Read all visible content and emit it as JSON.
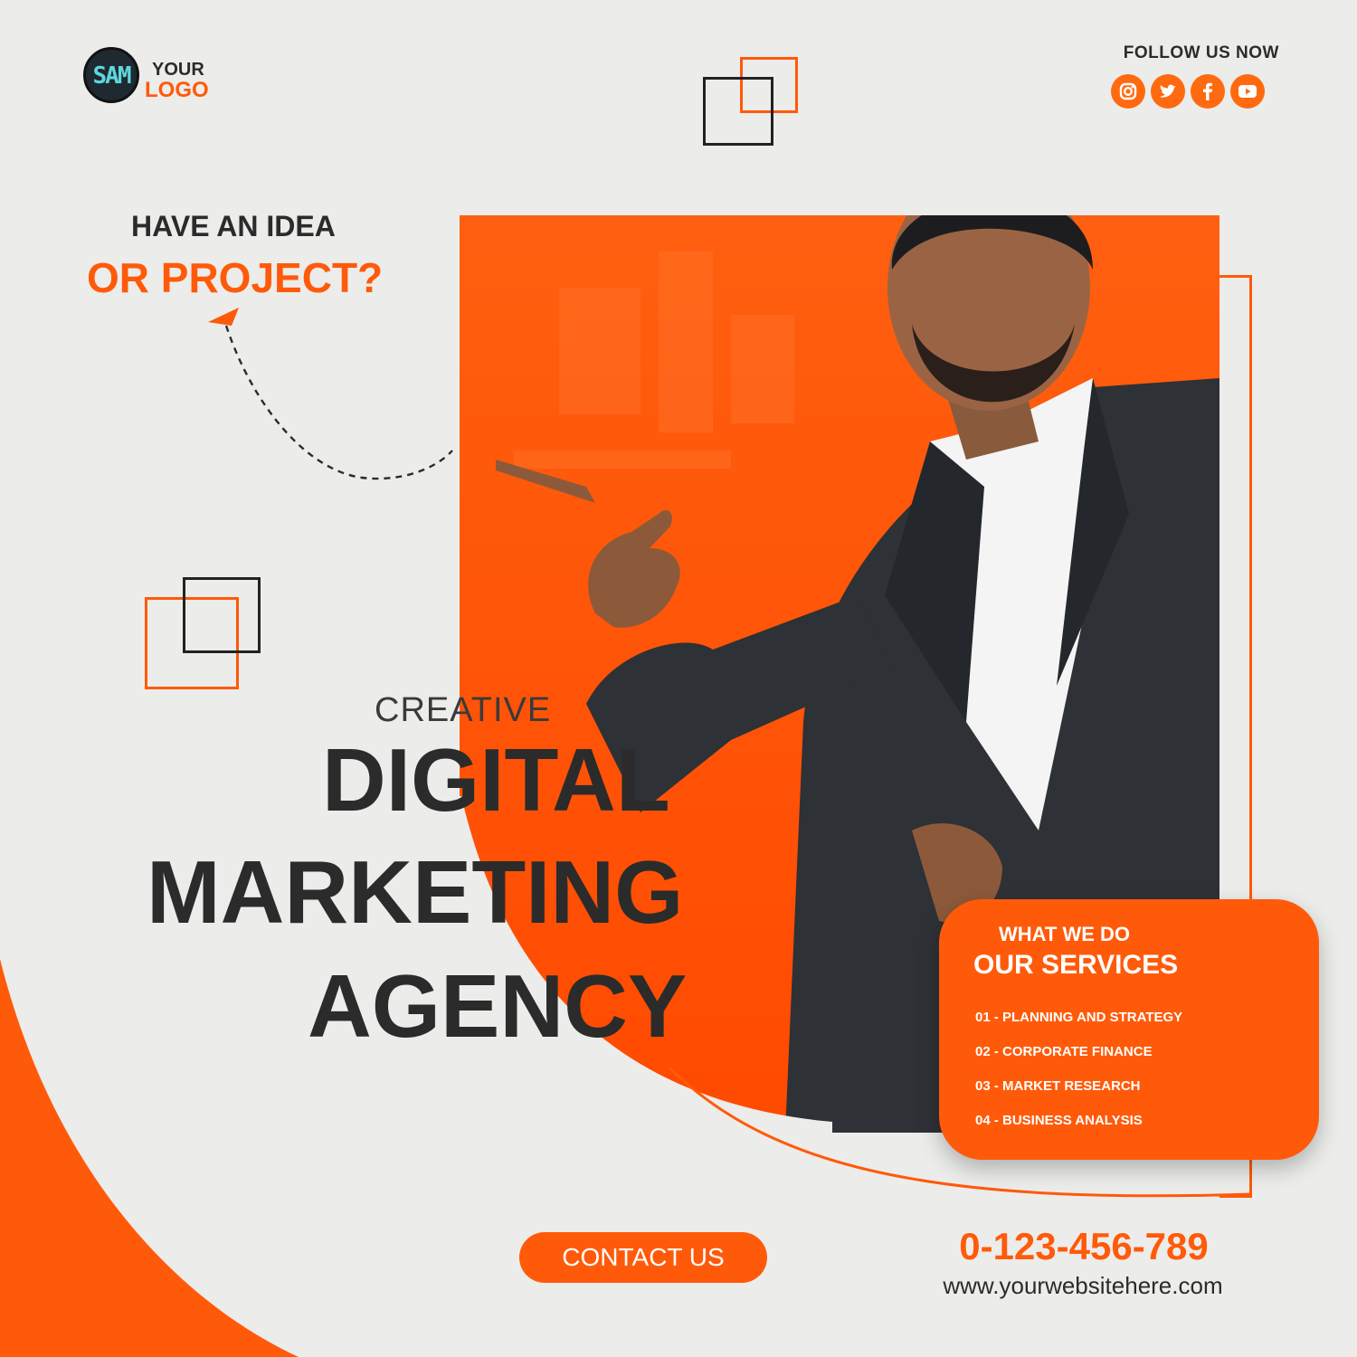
{
  "logo": {
    "mark_icon": "circular-monogram-logo",
    "line1": "YOUR",
    "line2": "LOGO"
  },
  "social": {
    "heading": "FOLLOW US NOW",
    "icons": [
      "instagram-icon",
      "twitter-icon",
      "facebook-icon",
      "youtube-icon"
    ]
  },
  "hero": {
    "idea_line1": "HAVE AN IDEA",
    "idea_line2": "OR PROJECT?",
    "eyebrow": "CREATIVE",
    "title_line1": "DIGITAL",
    "title_line2": "MARKETING",
    "title_line3": "AGENCY"
  },
  "services": {
    "subtitle": "WHAT WE DO",
    "title": "OUR SERVICES",
    "items": [
      "01 - PLANNING AND STRATEGY",
      "02 - CORPORATE FINANCE",
      "03 - MARKET RESEARCH",
      "04 - BUSINESS ANALYSIS"
    ]
  },
  "contact": {
    "button_label": "CONTACT US",
    "phone": "0-123-456-789",
    "website": "www.yourwebsitehere.com"
  },
  "colors": {
    "accent": "#ff5a0a",
    "text_dark": "#2b2b2b",
    "background": "#ececea"
  }
}
